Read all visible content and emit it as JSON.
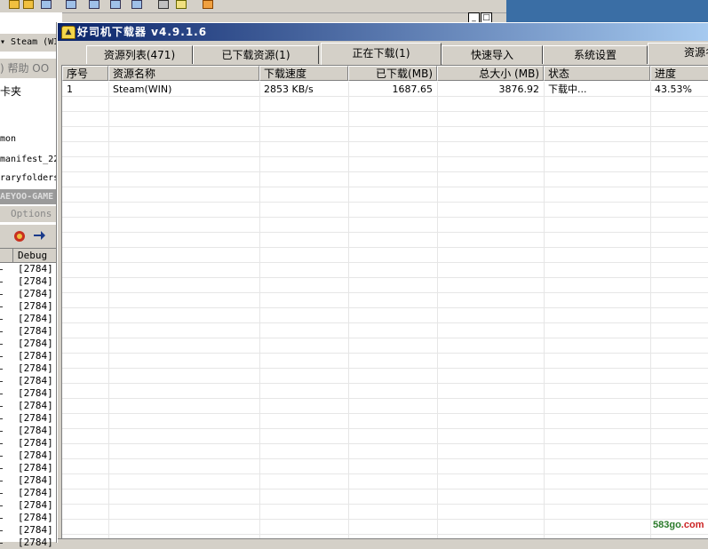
{
  "background_app": {
    "menu_path": "▾ Steam (WIN",
    "help_menu": ") 帮助 OO",
    "folder_label": "卡夹",
    "files": [
      "mon",
      "manifest_22",
      "raryfolders"
    ],
    "dark_bar": "AEYOO-GAME",
    "options_label": "Options",
    "column_debug": "Debug",
    "rows": [
      "[2784]",
      "[2784]",
      "[2784]",
      "[2784]",
      "[2784]",
      "[2784]",
      "[2784]",
      "[2784]",
      "[2784]",
      "[2784]",
      "[2784]",
      "[2784]",
      "[2784]",
      "[2784]",
      "[2784]",
      "[2784]",
      "[2784]",
      "[2784]",
      "[2784]",
      "[2784]",
      "[2784]",
      "[2784]",
      "[2784]"
    ]
  },
  "window": {
    "title": "好司机下载器 v4.9.1.6",
    "icon": "car-icon"
  },
  "tabs": [
    {
      "label": "资源列表(471)",
      "active": false
    },
    {
      "label": "已下载资源(1)",
      "active": false
    },
    {
      "label": "正在下载(1)",
      "active": true
    },
    {
      "label": "快速导入",
      "active": false
    },
    {
      "label": "系统设置",
      "active": false
    },
    {
      "label": "资源名",
      "active": false
    }
  ],
  "table": {
    "columns": [
      "序号",
      "资源名称",
      "下载速度",
      "已下载(MB)",
      "总大小 (MB)",
      "状态",
      "进度"
    ],
    "rows": [
      [
        "1",
        "Steam(WIN)",
        "2853 KB/s",
        "1687.65",
        "3876.92",
        "下载中...",
        "43.53%"
      ]
    ]
  },
  "watermark": {
    "text": "583go",
    "suffix": ".com"
  },
  "colors": {
    "titlebar_start": "#0a246a",
    "titlebar_end": "#a6caf0",
    "window_face": "#d4d0c8"
  }
}
